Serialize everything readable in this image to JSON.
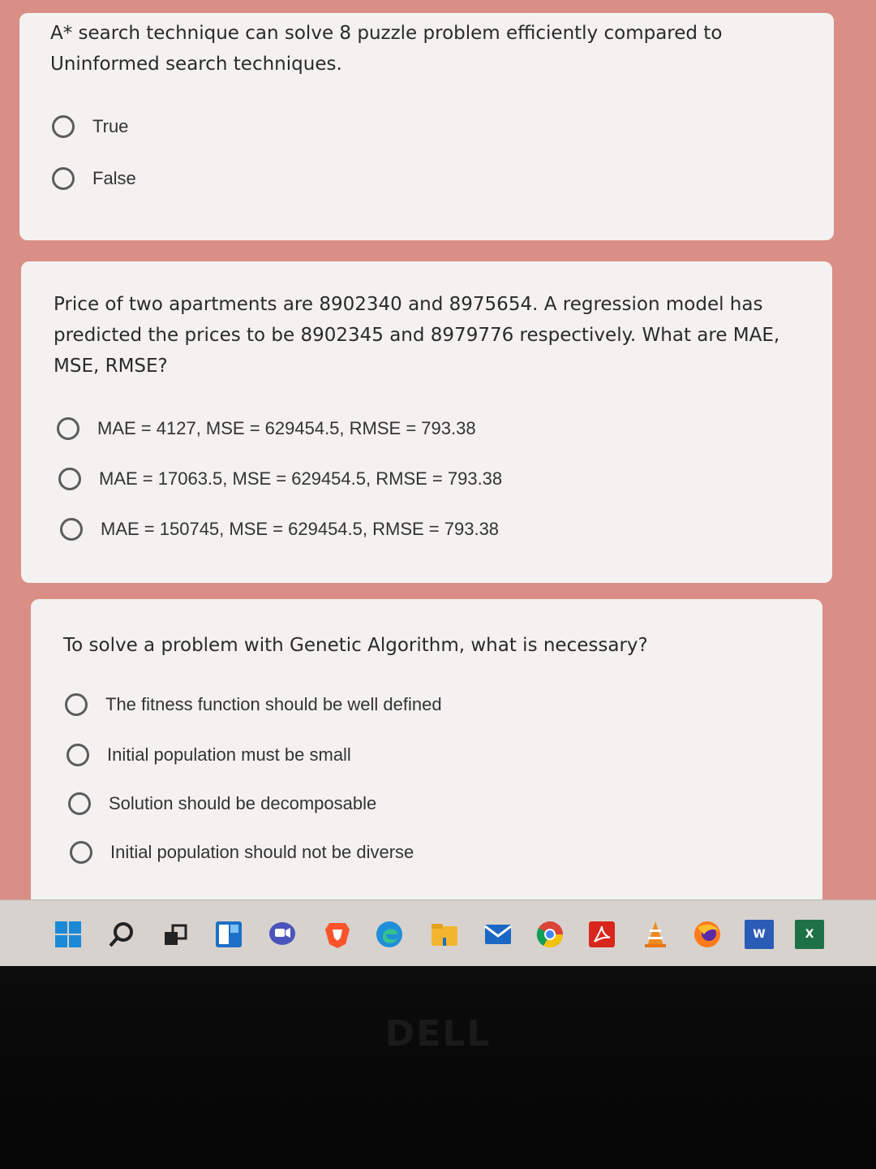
{
  "questions": [
    {
      "text": "A* search technique can solve 8 puzzle problem efficiently compared to Uninformed search techniques.",
      "options": [
        "True",
        "False"
      ]
    },
    {
      "text": "Price of two apartments are 8902340 and 8975654. A regression model has predicted the prices to be 8902345 and 8979776 respectively. What are MAE, MSE, RMSE?",
      "options": [
        "MAE = 4127, MSE = 629454.5, RMSE = 793.38",
        "MAE = 17063.5, MSE = 629454.5, RMSE = 793.38",
        "MAE = 150745, MSE = 629454.5, RMSE = 793.38"
      ]
    },
    {
      "text": "To solve a problem with Genetic Algorithm, what is necessary?",
      "options": [
        "The fitness function should be well defined",
        "Initial population must be small",
        "Solution should be decomposable",
        "Initial population should not be diverse"
      ]
    }
  ],
  "taskbar": {
    "icons": [
      "windows-start-icon",
      "search-icon",
      "task-view-icon",
      "widgets-icon",
      "chat-icon",
      "brave-browser-icon",
      "edge-browser-icon",
      "file-explorer-icon",
      "mail-icon",
      "chrome-browser-icon",
      "acrobat-reader-icon",
      "vlc-player-icon",
      "firefox-browser-icon",
      "word-icon",
      "excel-icon"
    ],
    "word_letter": "W",
    "excel_letter": "X"
  },
  "brand": "DELL",
  "colors": {
    "page_background": "#d98f86",
    "card_background": "#f3f2f0",
    "radio_border": "#5c5c5c"
  }
}
